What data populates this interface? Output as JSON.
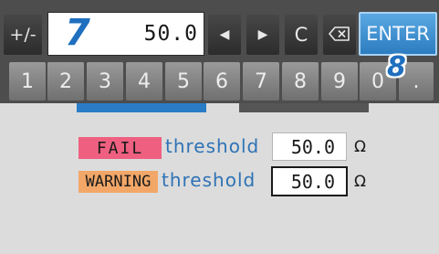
{
  "keypad": {
    "plus_minus": "+/-",
    "entry_value": "50.0",
    "left_arrow": "◀",
    "right_arrow": "▶",
    "clear": "C",
    "backspace_icon": "backspace-icon",
    "enter": "ENTER",
    "digits": [
      "1",
      "2",
      "3",
      "4",
      "5",
      "6",
      "7",
      "8",
      "9",
      "0",
      "."
    ]
  },
  "callouts": {
    "step_7": "7",
    "step_8": "8"
  },
  "thresholds": {
    "fail": {
      "badge": "FAIL",
      "label": "threshold",
      "value": "50.0",
      "unit": "Ω"
    },
    "warning": {
      "badge": "WARNING",
      "label": "threshold",
      "value": "50.0",
      "unit": "Ω"
    }
  },
  "colors": {
    "accent_blue": "#2a7cc7",
    "fail_badge": "#ef6080",
    "warning_badge": "#f2a768",
    "enter_button": "#3f93d3"
  }
}
